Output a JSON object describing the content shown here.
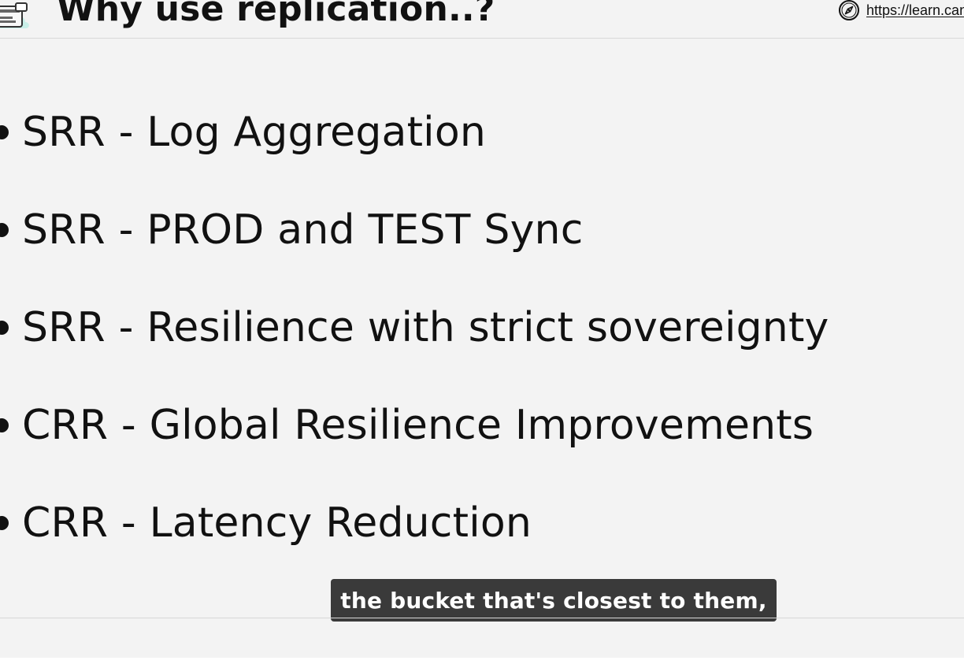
{
  "header": {
    "title": "Why use replication..?",
    "link_text": "https://learn.can"
  },
  "bullets": [
    {
      "text": "SRR - Log Aggregation"
    },
    {
      "text": "SRR - PROD and TEST Sync"
    },
    {
      "text": "SRR - Resilience with strict sovereignty"
    },
    {
      "text": "CRR - Global Resilience Improvements"
    },
    {
      "text": "CRR - Latency Reduction"
    }
  ],
  "subtitle": {
    "text": "the bucket that's closest to them,"
  },
  "icons": {
    "logo": "logo-icon",
    "compass": "compass-icon"
  }
}
